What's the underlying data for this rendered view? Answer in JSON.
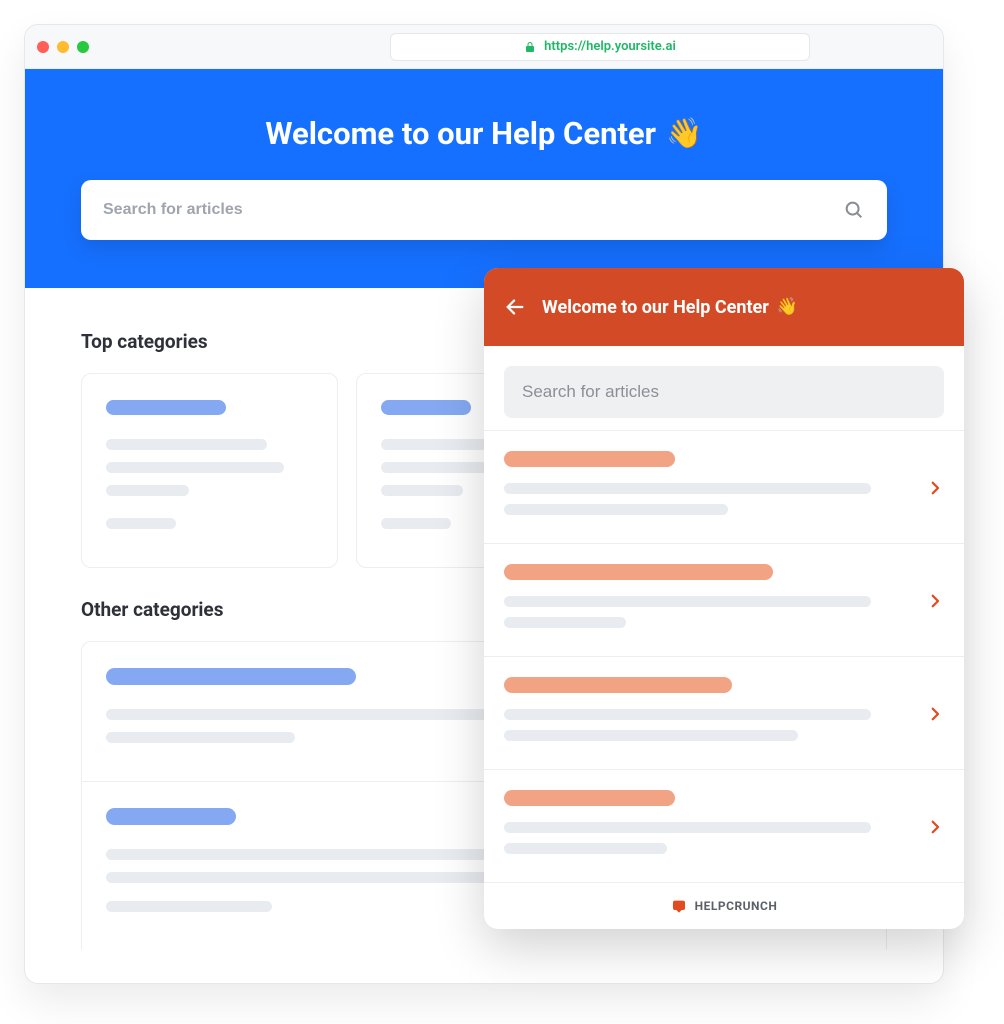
{
  "browser": {
    "url": "https://help.yoursite.ai"
  },
  "hero": {
    "title": "Welcome to our Help Center",
    "wave": "👋",
    "search_placeholder": "Search for articles"
  },
  "sections": {
    "top_title": "Top categories",
    "other_title": "Other categories"
  },
  "widget": {
    "title": "Welcome to our Help Center",
    "wave": "👋",
    "search_placeholder": "Search for articles",
    "footer_brand": "HELPCRUNCH"
  }
}
